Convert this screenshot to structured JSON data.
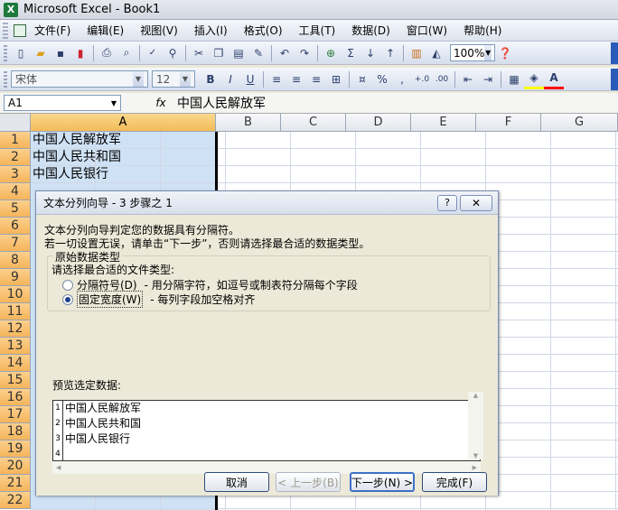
{
  "window": {
    "title": "Microsoft Excel - Book1",
    "app_icon": "X"
  },
  "menu": [
    {
      "label": "文件(F)"
    },
    {
      "label": "编辑(E)"
    },
    {
      "label": "视图(V)"
    },
    {
      "label": "插入(I)"
    },
    {
      "label": "格式(O)"
    },
    {
      "label": "工具(T)"
    },
    {
      "label": "数据(D)"
    },
    {
      "label": "窗口(W)"
    },
    {
      "label": "帮助(H)"
    }
  ],
  "toolbar": {
    "zoom": "100%",
    "font_name": "宋体",
    "font_size": "12",
    "bold": "B",
    "italic": "I",
    "underline": "U",
    "currency": "%",
    "comma": ",",
    "fill_color": "#ffff00",
    "font_color": "#ff0000"
  },
  "formula_bar": {
    "name_box": "A1",
    "fx": "fx",
    "content": "中国人民解放军"
  },
  "sheet": {
    "columns": [
      "A",
      "B",
      "C",
      "D",
      "E",
      "F",
      "G"
    ],
    "rows": [
      "1",
      "2",
      "3",
      "4",
      "5",
      "6",
      "7",
      "8",
      "9",
      "10",
      "11",
      "12",
      "13",
      "14",
      "15",
      "16",
      "17",
      "18",
      "19",
      "20",
      "21",
      "22"
    ],
    "cells": [
      "中国人民解放军",
      "中国人民共和国",
      "中国人民银行"
    ]
  },
  "dialog": {
    "title": "文本分列向导 - 3 步骤之 1",
    "help": "?",
    "close": "✕",
    "desc1": "文本分列向导判定您的数据具有分隔符。",
    "desc2": "若一切设置无误，请单击“下一步”，否则请选择最合适的数据类型。",
    "group_title": "原始数据类型",
    "group_prompt": "请选择最合适的文件类型:",
    "option_delimited": "分隔符号(D)",
    "option_delimited_desc": "- 用分隔字符，如逗号或制表符分隔每个字段",
    "option_fixed": "固定宽度(W)",
    "option_fixed_desc": "- 每列字段加空格对齐",
    "selected_option": "fixed",
    "preview_label": "预览选定数据:",
    "preview": [
      {
        "num": "1",
        "text": "中国人民解放军"
      },
      {
        "num": "2",
        "text": "中国人民共和国"
      },
      {
        "num": "3",
        "text": "中国人民银行"
      },
      {
        "num": "4",
        "text": ""
      }
    ],
    "buttons": {
      "cancel": "取消",
      "back": "< 上一步(B)",
      "next": "下一步(N) >",
      "finish": "完成(F)"
    }
  }
}
